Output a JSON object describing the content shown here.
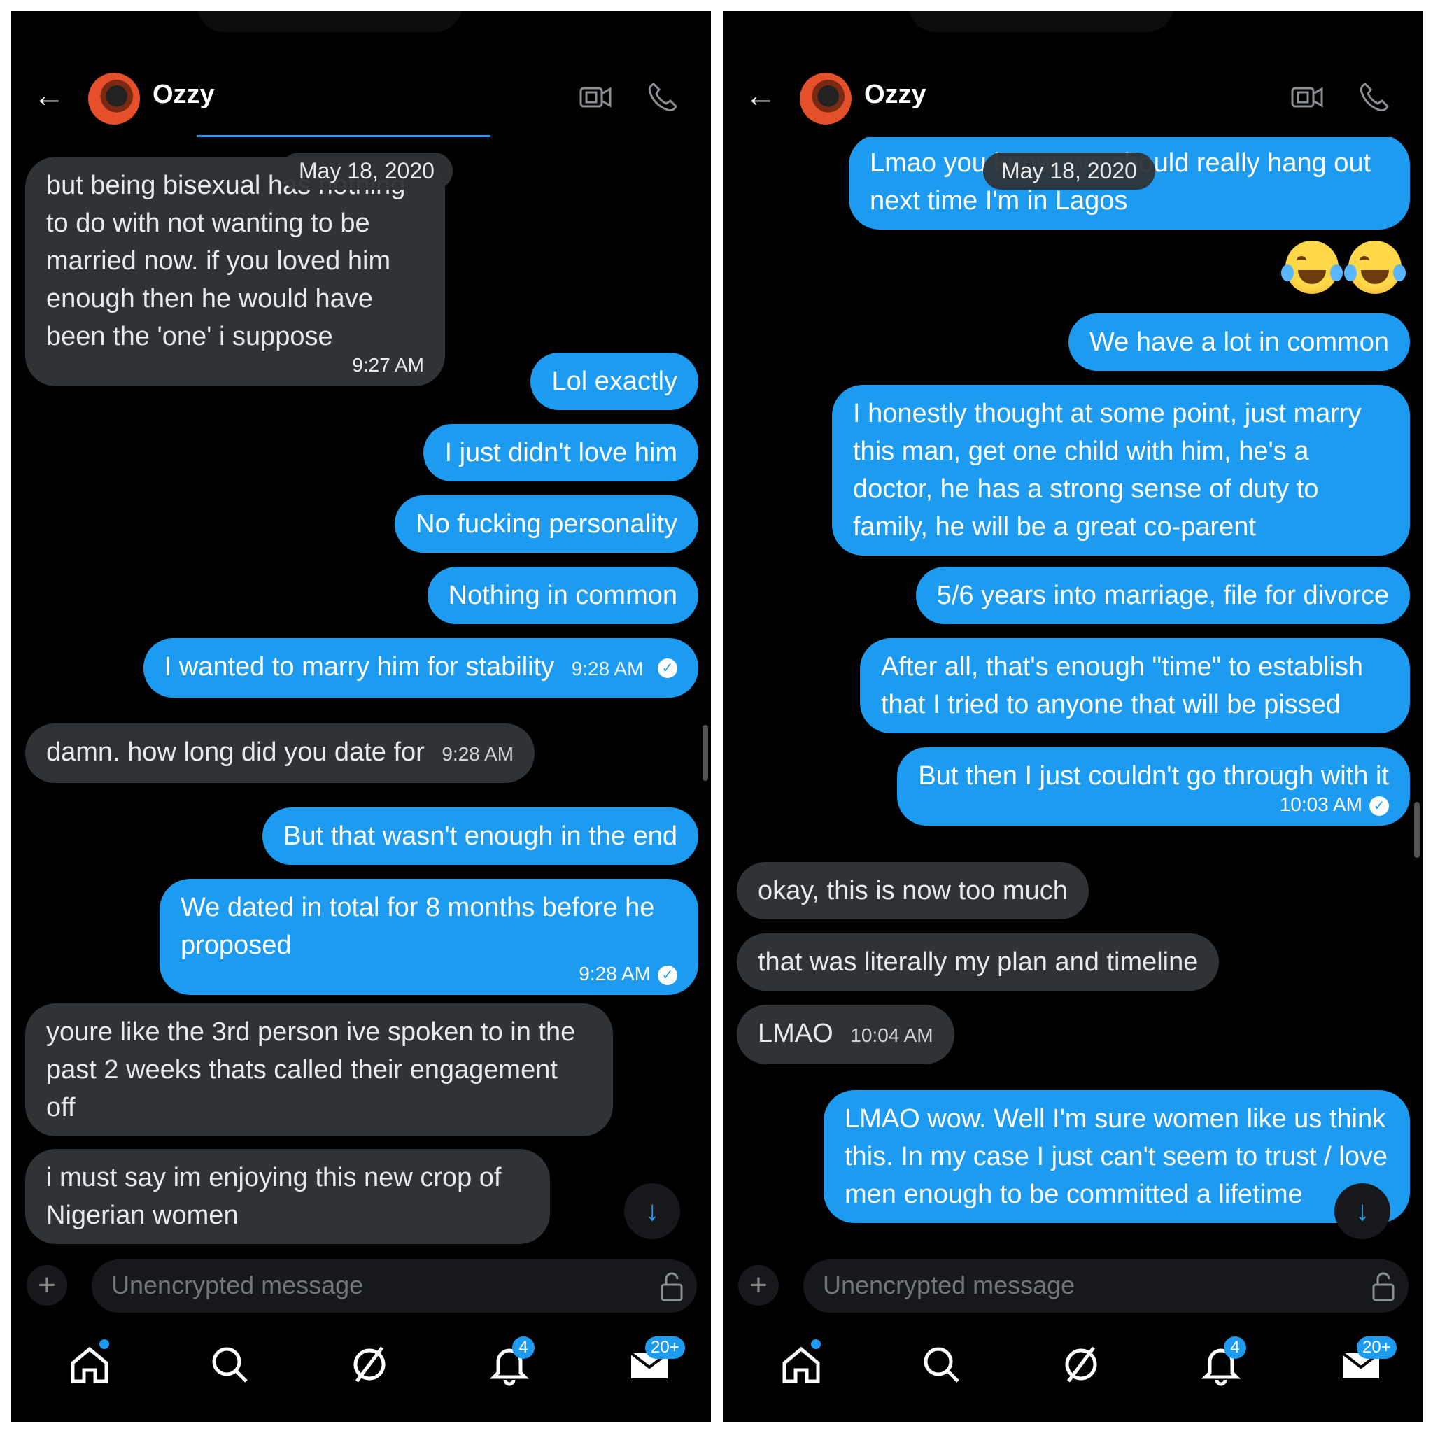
{
  "header": {
    "contact_name": "Ozzy"
  },
  "date_label": "May 18, 2020",
  "composer": {
    "placeholder": "Unencrypted message"
  },
  "nav": {
    "notifications_badge": "4",
    "messages_badge": "20+"
  },
  "left": {
    "messages": [
      {
        "text": "but being bisexual has nothing to do with not wanting to be married now. if you loved him enough then he would have been the 'one' i suppose",
        "time": "9:27 AM"
      },
      {
        "text": "Lol exactly"
      },
      {
        "text": "I just didn't love him"
      },
      {
        "text": "No fucking personality"
      },
      {
        "text": "Nothing in common"
      },
      {
        "text": "I wanted to marry him for stability",
        "time": "9:28 AM"
      },
      {
        "text": "damn. how long did you date for",
        "time": "9:28 AM"
      },
      {
        "text": "But that wasn't enough in the end"
      },
      {
        "text": "We dated in total for 8 months before he proposed",
        "time": "9:28 AM"
      },
      {
        "text": "youre like the 3rd person ive spoken to in the past 2 weeks thats called their engagement off"
      },
      {
        "text": "i must say im enjoying this new crop of Nigerian women"
      }
    ]
  },
  "right": {
    "messages": [
      {
        "text": "Lmao you know, we should really hang out next time I'm in Lagos"
      },
      {
        "text": "We have a lot in common"
      },
      {
        "text": "I honestly thought at some point, just marry this man, get one child with him, he's a doctor, he has a strong sense of duty to family, he will be a great co-parent"
      },
      {
        "text": "5/6 years into marriage, file for divorce"
      },
      {
        "text": "After all, that's enough \"time\" to establish that I tried to anyone that will be pissed"
      },
      {
        "text": "But then I just couldn't go through with it",
        "time": "10:03 AM"
      },
      {
        "text": "okay, this is now too much"
      },
      {
        "text": "that was literally my plan and timeline"
      },
      {
        "text": "LMAO",
        "time": "10:04 AM"
      },
      {
        "text": "LMAO wow. Well I'm sure women like us think this. In my case I just can't seem to trust / love men enough to be committed a lifetime"
      }
    ]
  },
  "colors": {
    "sent_bubble": "#1d9bf0",
    "received_bubble": "#2f3336",
    "background": "#000000"
  }
}
